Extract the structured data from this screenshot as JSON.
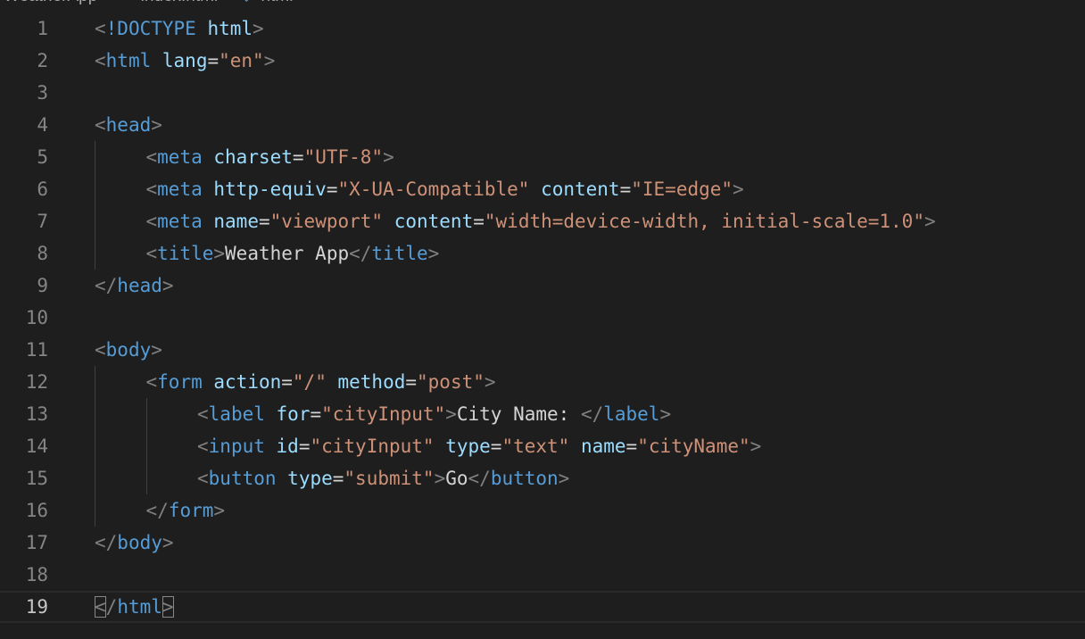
{
  "breadcrumb": {
    "folder": "WeatherApp",
    "file": "index.html",
    "symbol": "html"
  },
  "colors": {
    "background": "#1e1e1e",
    "line_number": "#858585",
    "tag": "#569cd6",
    "attribute": "#9cdcfe",
    "string": "#ce9178",
    "punctuation": "#808080",
    "text": "#d4d4d4"
  },
  "editor": {
    "current_line": 19,
    "lines": [
      {
        "num": "1",
        "indent": 0,
        "tokens": [
          [
            "p",
            "<"
          ],
          [
            "t",
            "!DOCTYPE"
          ],
          [
            "x",
            " "
          ],
          [
            "a",
            "html"
          ],
          [
            "p",
            ">"
          ]
        ]
      },
      {
        "num": "2",
        "indent": 0,
        "tokens": [
          [
            "p",
            "<"
          ],
          [
            "t",
            "html"
          ],
          [
            "x",
            " "
          ],
          [
            "a",
            "lang"
          ],
          [
            "x",
            "="
          ],
          [
            "s",
            "\"en\""
          ],
          [
            "p",
            ">"
          ]
        ]
      },
      {
        "num": "3",
        "indent": 0,
        "tokens": []
      },
      {
        "num": "4",
        "indent": 0,
        "tokens": [
          [
            "p",
            "<"
          ],
          [
            "t",
            "head"
          ],
          [
            "p",
            ">"
          ]
        ]
      },
      {
        "num": "5",
        "indent": 1,
        "tokens": [
          [
            "p",
            "<"
          ],
          [
            "t",
            "meta"
          ],
          [
            "x",
            " "
          ],
          [
            "a",
            "charset"
          ],
          [
            "x",
            "="
          ],
          [
            "s",
            "\"UTF-8\""
          ],
          [
            "p",
            ">"
          ]
        ]
      },
      {
        "num": "6",
        "indent": 1,
        "tokens": [
          [
            "p",
            "<"
          ],
          [
            "t",
            "meta"
          ],
          [
            "x",
            " "
          ],
          [
            "a",
            "http-equiv"
          ],
          [
            "x",
            "="
          ],
          [
            "s",
            "\"X-UA-Compatible\""
          ],
          [
            "x",
            " "
          ],
          [
            "a",
            "content"
          ],
          [
            "x",
            "="
          ],
          [
            "s",
            "\"IE=edge\""
          ],
          [
            "p",
            ">"
          ]
        ]
      },
      {
        "num": "7",
        "indent": 1,
        "tokens": [
          [
            "p",
            "<"
          ],
          [
            "t",
            "meta"
          ],
          [
            "x",
            " "
          ],
          [
            "a",
            "name"
          ],
          [
            "x",
            "="
          ],
          [
            "s",
            "\"viewport\""
          ],
          [
            "x",
            " "
          ],
          [
            "a",
            "content"
          ],
          [
            "x",
            "="
          ],
          [
            "s",
            "\"width=device-width, initial-scale=1.0\""
          ],
          [
            "p",
            ">"
          ]
        ]
      },
      {
        "num": "8",
        "indent": 1,
        "tokens": [
          [
            "p",
            "<"
          ],
          [
            "t",
            "title"
          ],
          [
            "p",
            ">"
          ],
          [
            "x",
            "Weather App"
          ],
          [
            "p",
            "</"
          ],
          [
            "t",
            "title"
          ],
          [
            "p",
            ">"
          ]
        ]
      },
      {
        "num": "9",
        "indent": 0,
        "tokens": [
          [
            "p",
            "</"
          ],
          [
            "t",
            "head"
          ],
          [
            "p",
            ">"
          ]
        ]
      },
      {
        "num": "10",
        "indent": 0,
        "tokens": []
      },
      {
        "num": "11",
        "indent": 0,
        "tokens": [
          [
            "p",
            "<"
          ],
          [
            "t",
            "body"
          ],
          [
            "p",
            ">"
          ]
        ]
      },
      {
        "num": "12",
        "indent": 1,
        "tokens": [
          [
            "p",
            "<"
          ],
          [
            "t",
            "form"
          ],
          [
            "x",
            " "
          ],
          [
            "a",
            "action"
          ],
          [
            "x",
            "="
          ],
          [
            "s",
            "\"/\""
          ],
          [
            "x",
            " "
          ],
          [
            "a",
            "method"
          ],
          [
            "x",
            "="
          ],
          [
            "s",
            "\"post\""
          ],
          [
            "p",
            ">"
          ]
        ]
      },
      {
        "num": "13",
        "indent": 2,
        "tokens": [
          [
            "p",
            "<"
          ],
          [
            "t",
            "label"
          ],
          [
            "x",
            " "
          ],
          [
            "a",
            "for"
          ],
          [
            "x",
            "="
          ],
          [
            "s",
            "\"cityInput\""
          ],
          [
            "p",
            ">"
          ],
          [
            "x",
            "City Name: "
          ],
          [
            "p",
            "</"
          ],
          [
            "t",
            "label"
          ],
          [
            "p",
            ">"
          ]
        ]
      },
      {
        "num": "14",
        "indent": 2,
        "tokens": [
          [
            "p",
            "<"
          ],
          [
            "t",
            "input"
          ],
          [
            "x",
            " "
          ],
          [
            "a",
            "id"
          ],
          [
            "x",
            "="
          ],
          [
            "s",
            "\"cityInput\""
          ],
          [
            "x",
            " "
          ],
          [
            "a",
            "type"
          ],
          [
            "x",
            "="
          ],
          [
            "s",
            "\"text\""
          ],
          [
            "x",
            " "
          ],
          [
            "a",
            "name"
          ],
          [
            "x",
            "="
          ],
          [
            "s",
            "\"cityName\""
          ],
          [
            "p",
            ">"
          ]
        ]
      },
      {
        "num": "15",
        "indent": 2,
        "tokens": [
          [
            "p",
            "<"
          ],
          [
            "t",
            "button"
          ],
          [
            "x",
            " "
          ],
          [
            "a",
            "type"
          ],
          [
            "x",
            "="
          ],
          [
            "s",
            "\"submit\""
          ],
          [
            "p",
            ">"
          ],
          [
            "x",
            "Go"
          ],
          [
            "p",
            "</"
          ],
          [
            "t",
            "button"
          ],
          [
            "p",
            ">"
          ]
        ]
      },
      {
        "num": "16",
        "indent": 1,
        "tokens": [
          [
            "p",
            "</"
          ],
          [
            "t",
            "form"
          ],
          [
            "p",
            ">"
          ]
        ]
      },
      {
        "num": "17",
        "indent": 0,
        "tokens": [
          [
            "p",
            "</"
          ],
          [
            "t",
            "body"
          ],
          [
            "p",
            ">"
          ]
        ]
      },
      {
        "num": "18",
        "indent": 0,
        "tokens": []
      },
      {
        "num": "19",
        "indent": 0,
        "tokens": [
          [
            "pm",
            "<"
          ],
          [
            "p",
            "/"
          ],
          [
            "t",
            "html"
          ],
          [
            "pm",
            ">"
          ]
        ]
      }
    ]
  }
}
